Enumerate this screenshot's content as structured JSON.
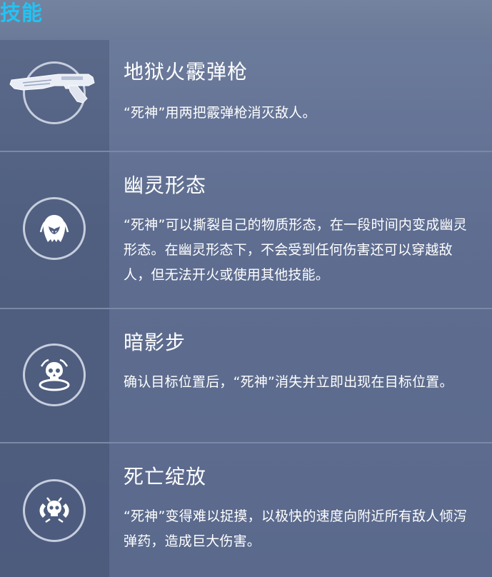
{
  "header": {
    "title": "技能"
  },
  "abilities": [
    {
      "name": "地狱火霰弹枪",
      "description": "“死神”用两把霰弹枪消灭敌人。",
      "icon": "shotgun-icon"
    },
    {
      "name": "幽灵形态",
      "description": "“死神”可以撕裂自己的物质形态，在一段时间内变成幽灵形态。在幽灵形态下，不会受到任何伤害还可以穿越敌人，但无法开火或使用其他技能。",
      "icon": "wraith-form-icon"
    },
    {
      "name": "暗影步",
      "description": "确认目标位置后，“死神”消失并立即出现在目标位置。",
      "icon": "shadow-step-icon"
    },
    {
      "name": "死亡绽放",
      "description": "“死神”变得难以捉摸，以极快的速度向附近所有敌人倾泻弹药，造成巨大伤害。",
      "icon": "death-blossom-icon"
    }
  ],
  "colors": {
    "accent": "#23c3f3",
    "text": "#ffffff",
    "circle": "#c6cddd",
    "background": "#5b6b8e"
  }
}
